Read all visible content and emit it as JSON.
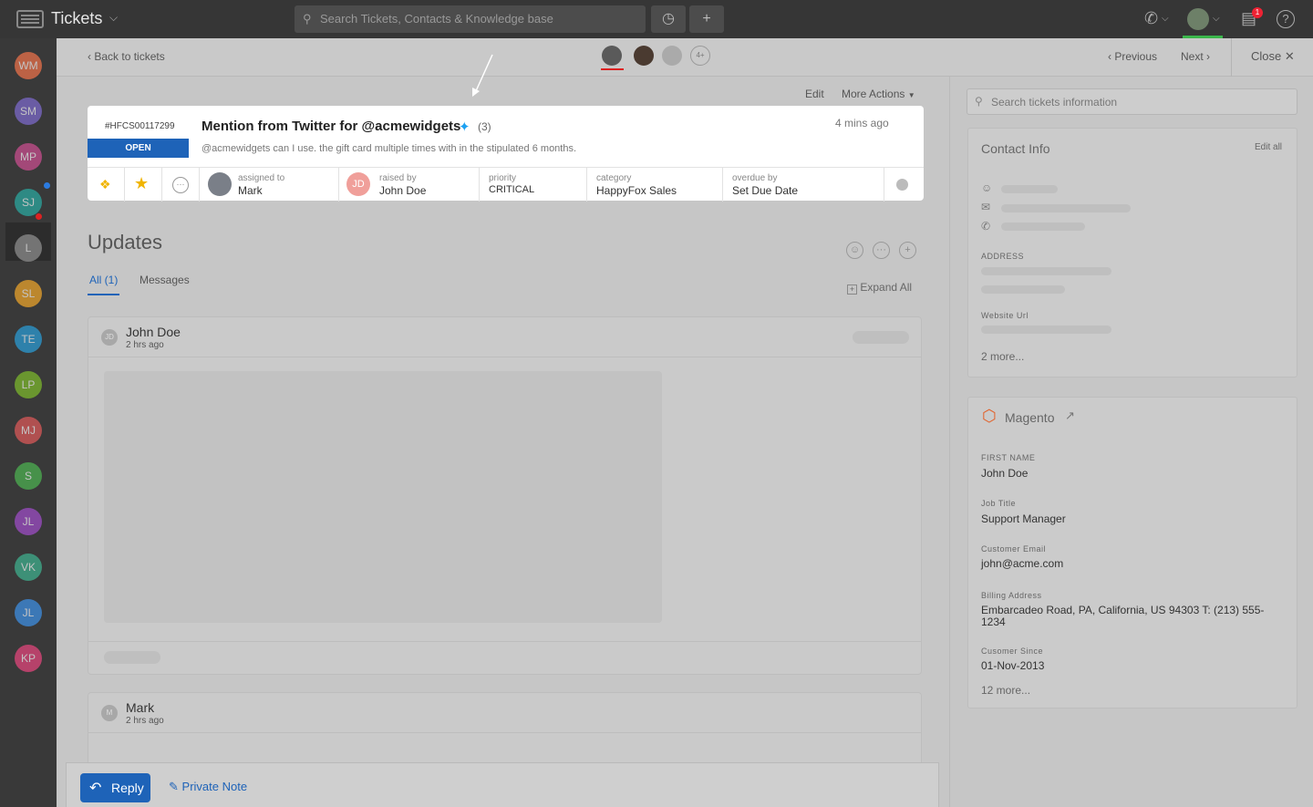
{
  "topbar": {
    "app_title": "Tickets",
    "search_placeholder": "Search Tickets, Contacts & Knowledge base",
    "notification_count": "1"
  },
  "sidebar": {
    "agents": [
      {
        "initials": "WM",
        "color": "#e8704a"
      },
      {
        "initials": "SM",
        "color": "#7b68c8"
      },
      {
        "initials": "MP",
        "color": "#c74d8d"
      },
      {
        "initials": "SJ",
        "color": "#2ba59e"
      },
      {
        "initials": "L",
        "color": "#8c8c8c"
      },
      {
        "initials": "SL",
        "color": "#e8a22b"
      },
      {
        "initials": "TE",
        "color": "#2b9ad1"
      },
      {
        "initials": "LP",
        "color": "#7bb52c"
      },
      {
        "initials": "MJ",
        "color": "#d85858"
      },
      {
        "initials": "S",
        "color": "#4caf50"
      },
      {
        "initials": "JL",
        "color": "#9c4cc4"
      },
      {
        "initials": "VK",
        "color": "#3fae8c"
      },
      {
        "initials": "JL",
        "color": "#3d8de0"
      },
      {
        "initials": "KP",
        "color": "#e0457b"
      }
    ]
  },
  "subbar": {
    "back_label": "Back to tickets",
    "watchers_more": "4+",
    "previous_label": "Previous",
    "next_label": "Next",
    "close_label": "Close"
  },
  "ticket": {
    "edit_label": "Edit",
    "more_actions_label": "More Actions",
    "id": "#HFCS00117299",
    "status": "OPEN",
    "title": "Mention from Twitter for @acmewidgets",
    "count": "(3)",
    "time_ago": "4 mins ago",
    "message": "@acmewidgets can I use. the gift card multiple times with in the stipulated 6 months.",
    "assigned_label": "assigned to",
    "assigned_value": "Mark",
    "raised_label": "raised by",
    "raised_value": "John Doe",
    "raised_initials": "JD",
    "priority_label": "priority",
    "priority_value": "CRITICAL",
    "category_label": "category",
    "category_value": "HappyFox Sales",
    "overdue_label": "overdue by",
    "overdue_value": "Set Due Date"
  },
  "updates": {
    "title": "Updates",
    "tab_all": "All (1)",
    "tab_messages": "Messages",
    "expand_all": "Expand All",
    "cards": [
      {
        "initials": "JD",
        "name": "John Doe",
        "time": "2 hrs ago"
      },
      {
        "initials": "M",
        "name": "Mark",
        "time": "2 hrs ago"
      }
    ]
  },
  "composer": {
    "reply_label": "Reply",
    "private_note_label": "Private Note"
  },
  "right_panel": {
    "search_placeholder": "Search tickets information",
    "contact_info": {
      "title": "Contact Info",
      "edit_all": "Edit all",
      "address_label": "ADDRESS",
      "website_label": "Website Url",
      "more": "2 more..."
    },
    "magento": {
      "title": "Magento",
      "fields": [
        {
          "label": "FIRST NAME",
          "value": "John Doe"
        },
        {
          "label": "Job Title",
          "value": "Support Manager"
        },
        {
          "label": "Customer Email",
          "value": "john@acme.com"
        },
        {
          "label": "Billing Address",
          "value": "Embarcadeo Road, PA, California, US 94303 T: (213) 555-1234"
        },
        {
          "label": "Cusomer Since",
          "value": "01-Nov-2013"
        }
      ],
      "more": "12 more..."
    }
  },
  "colors": {
    "accent": "#1e63b8",
    "twitter": "#1da1f2",
    "topbar": "#363636",
    "online": "#3ab54a"
  }
}
